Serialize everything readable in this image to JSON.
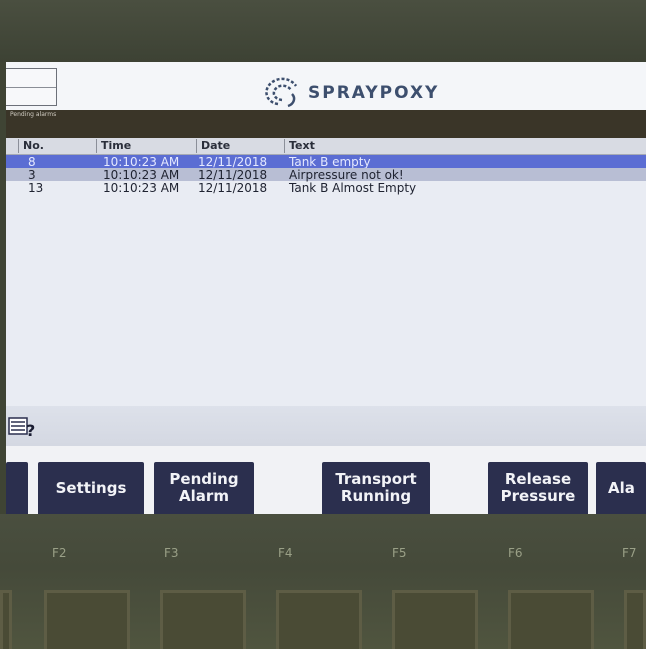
{
  "header": {
    "logo_text": "SPRAYPOXY",
    "strip_label": "Pending alarms"
  },
  "alarm_table": {
    "columns": [
      "No.",
      "Time",
      "Date",
      "Text"
    ],
    "rows": [
      {
        "no": "8",
        "time": "10:10:23 AM",
        "date": "12/11/2018",
        "text": "Tank B empty"
      },
      {
        "no": "3",
        "time": "10:10:23 AM",
        "date": "12/11/2018",
        "text": "Airpressure not ok!"
      },
      {
        "no": "13",
        "time": "10:10:23 AM",
        "date": "12/11/2018",
        "text": "Tank B Almost Empty"
      }
    ]
  },
  "help": {
    "icon": "alarm-help-icon"
  },
  "softkeys": [
    {
      "line1": "Settings",
      "line2": ""
    },
    {
      "line1": "Pending",
      "line2": "Alarm"
    },
    {
      "line1": "Transport",
      "line2": "Running"
    },
    {
      "line1": "Release",
      "line2": "Pressure"
    },
    {
      "line1": "Ala",
      "line2": ""
    }
  ],
  "function_keys": [
    "F2",
    "F3",
    "F4",
    "F5",
    "F6",
    "F7"
  ],
  "colors": {
    "selected_row": "#5b6dd3",
    "softkey_bg": "#2b2f4e",
    "bezel": "#3f4434"
  }
}
